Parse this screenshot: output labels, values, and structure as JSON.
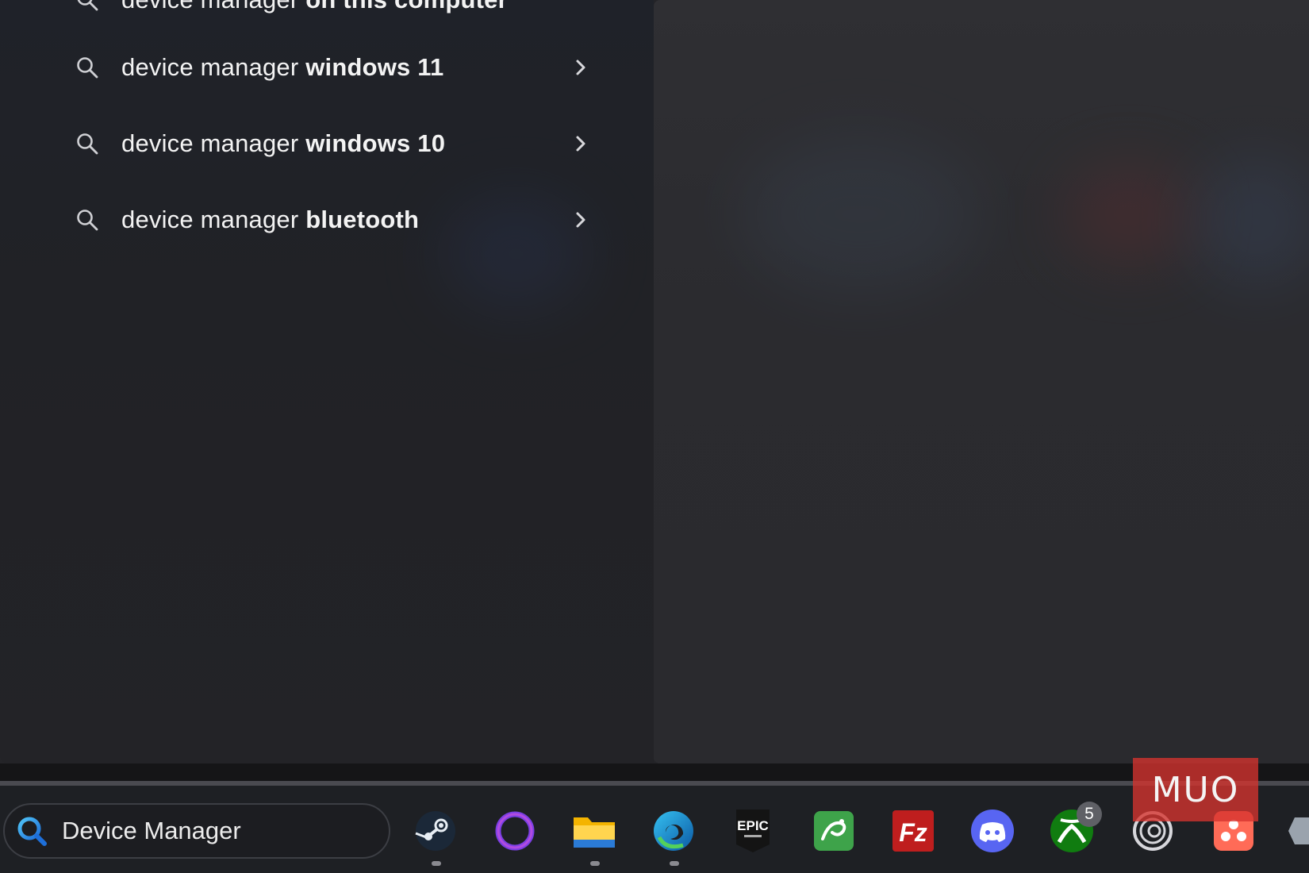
{
  "search_suggestions": {
    "partial_item": {
      "normal": "device manager",
      "bold": "on this computer"
    },
    "items": [
      {
        "normal": "device manager ",
        "bold": "windows 11"
      },
      {
        "normal": "device manager ",
        "bold": "windows 10"
      },
      {
        "normal": "device manager ",
        "bold": "bluetooth"
      }
    ]
  },
  "taskbar": {
    "search_value": "Device Manager",
    "apps": [
      {
        "icon": "steam-icon"
      },
      {
        "icon": "cortana-icon"
      },
      {
        "icon": "file-explorer-icon"
      },
      {
        "icon": "edge-icon"
      },
      {
        "icon": "epic-games-icon",
        "text": "EPIC"
      },
      {
        "icon": "snake-app-icon"
      },
      {
        "icon": "filezilla-icon",
        "text": "Fz"
      },
      {
        "icon": "discord-icon"
      },
      {
        "icon": "xbox-icon"
      },
      {
        "icon": "ubisoft-icon"
      },
      {
        "icon": "app-icon"
      }
    ],
    "xbox_badge": "5"
  },
  "watermark": "MUO",
  "colors": {
    "taskbar_bg": "#1e2024",
    "pane_left": "#222327",
    "pane_right": "#2d2d31"
  }
}
